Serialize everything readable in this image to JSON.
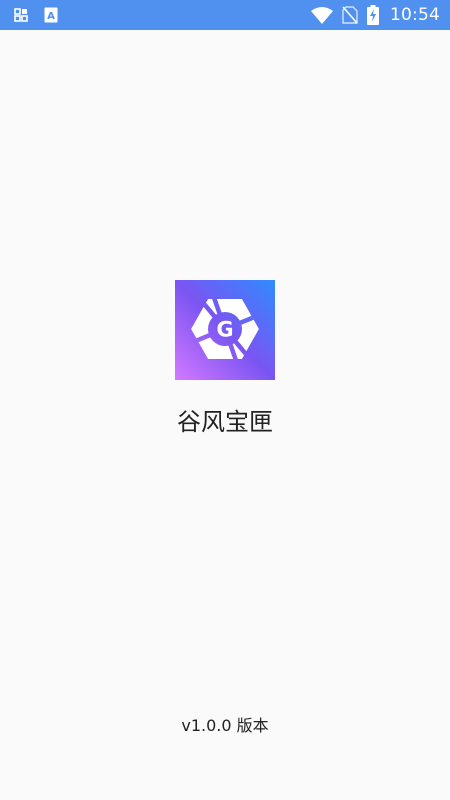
{
  "status_bar": {
    "time": "10:54",
    "color": "#5090ef",
    "left_icons": [
      "quick-settings-icon",
      "font-a-icon"
    ],
    "right_icons": [
      "wifi-icon",
      "no-sim-icon",
      "battery-charging-icon"
    ]
  },
  "splash": {
    "app_name": "谷风宝匣",
    "logo_icon": "camera-aperture-g-logo-icon",
    "logo_letter": "G",
    "logo_gradient": [
      "#2f8cff",
      "#7a55f2",
      "#d478ff"
    ],
    "version": "v1.0.0 版本"
  }
}
